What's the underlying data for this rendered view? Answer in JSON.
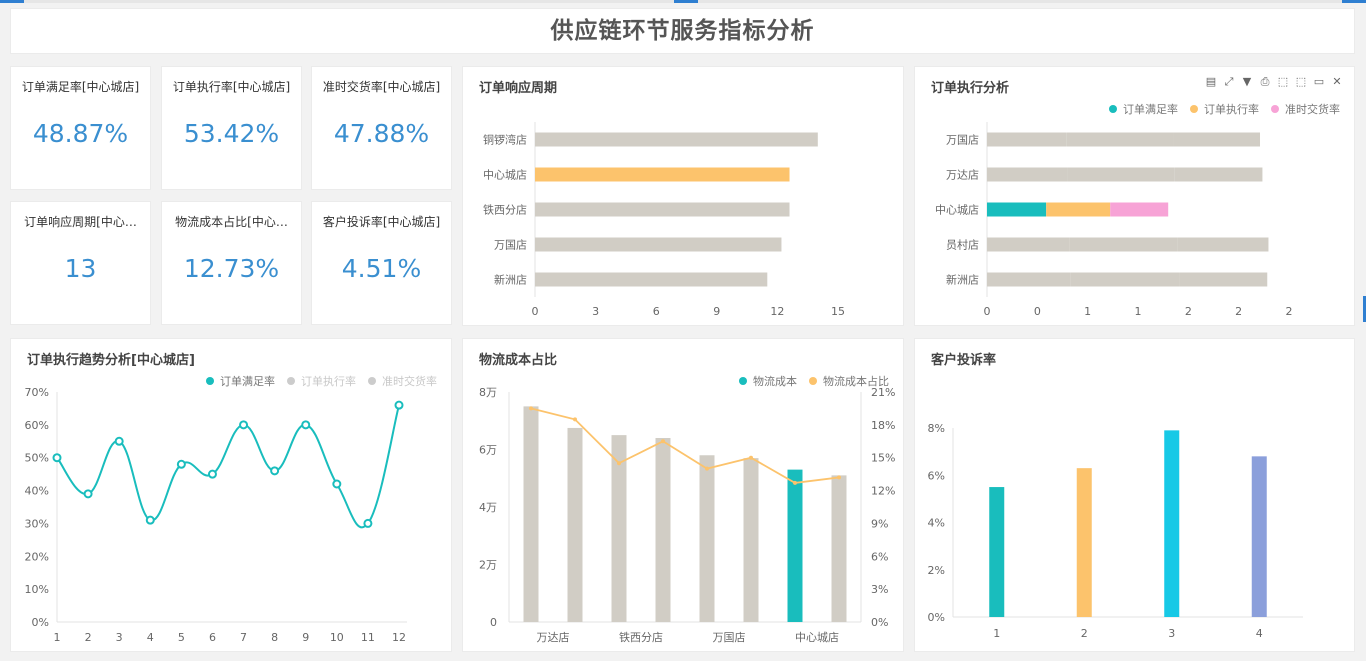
{
  "page_title": "供应链环节服务指标分析",
  "colors": {
    "teal": "#19bdbd",
    "orange": "#fcc36c",
    "pink": "#f7a3d6",
    "gray": "#d1cdc5",
    "cyan": "#17c9e6",
    "purple": "#8b9fdb",
    "kpi": "#3a8fd0"
  },
  "kpis": [
    {
      "title": "订单满足率[中心城店]",
      "value": "48.87%"
    },
    {
      "title": "订单执行率[中心城店]",
      "value": "53.42%"
    },
    {
      "title": "准时交货率[中心城店]",
      "value": "47.88%"
    },
    {
      "title": "订单响应周期[中心…",
      "value": "13"
    },
    {
      "title": "物流成本占比[中心…",
      "value": "12.73%"
    },
    {
      "title": "客户投诉率[中心城店]",
      "value": "4.51%"
    }
  ],
  "panels": {
    "response": {
      "title": "订单响应周期"
    },
    "execution": {
      "title": "订单执行分析",
      "toolbar": [
        "▤",
        "⤢",
        "▼",
        "⎙",
        "⬚",
        "⬚",
        "▭",
        "✕"
      ]
    },
    "trend": {
      "title": "订单执行趋势分析[中心城店]"
    },
    "logistics": {
      "title": "物流成本占比"
    },
    "complaint": {
      "title": "客户投诉率"
    }
  },
  "chart_data": [
    {
      "id": "response",
      "type": "bar",
      "orientation": "horizontal",
      "categories": [
        "铜锣湾店",
        "中心城店",
        "铁西分店",
        "万国店",
        "新洲店"
      ],
      "values": [
        14,
        12.6,
        12.6,
        12.2,
        11.5
      ],
      "highlight": "中心城店",
      "xlim": [
        0,
        15
      ],
      "xticks": [
        "0",
        "3",
        "6",
        "9",
        "12",
        "15"
      ]
    },
    {
      "id": "execution",
      "type": "bar",
      "orientation": "horizontal",
      "stacked": true,
      "categories": [
        "万国店",
        "万达店",
        "中心城店",
        "员村店",
        "新洲店"
      ],
      "series": [
        {
          "name": "订单满足率",
          "values": [
            0.66,
            0.67,
            0.49,
            0.68,
            0.69
          ]
        },
        {
          "name": "订单执行率",
          "values": [
            0.88,
            0.88,
            0.53,
            0.9,
            0.9
          ]
        },
        {
          "name": "准时交货率",
          "values": [
            0.72,
            0.73,
            0.48,
            0.75,
            0.73
          ]
        }
      ],
      "highlight": "中心城店",
      "xlim": [
        0,
        2.5
      ],
      "xticks": [
        "0",
        "0",
        "1",
        "1",
        "2",
        "2",
        "2"
      ],
      "legend_position": "top-right"
    },
    {
      "id": "trend",
      "type": "line",
      "x": [
        "1",
        "2",
        "3",
        "4",
        "5",
        "6",
        "7",
        "8",
        "9",
        "10",
        "11",
        "12"
      ],
      "series": [
        {
          "name": "订单满足率",
          "values": [
            50,
            39,
            55,
            31,
            48,
            45,
            60,
            46,
            60,
            42,
            30,
            66
          ]
        }
      ],
      "legend": [
        "订单满足率",
        "订单执行率",
        "准时交货率"
      ],
      "ylim": [
        0,
        70
      ],
      "yticks": [
        "0%",
        "10%",
        "20%",
        "30%",
        "40%",
        "50%",
        "60%",
        "70%"
      ]
    },
    {
      "id": "logistics",
      "type": "bar",
      "categories": [
        "万达店",
        "",
        "铁西分店",
        "",
        "万国店",
        "",
        "中心城店",
        ""
      ],
      "series": [
        {
          "name": "物流成本",
          "values": [
            75000,
            67500,
            65000,
            64000,
            58000,
            57000,
            53000,
            51000
          ]
        },
        {
          "name": "物流成本占比",
          "type": "line",
          "values": [
            19.5,
            18.5,
            14.5,
            16.5,
            14.0,
            15.0,
            12.7,
            13.2
          ]
        }
      ],
      "highlight_index": 6,
      "ylim": [
        0,
        80000
      ],
      "yticks": [
        "0",
        "2万",
        "4万",
        "6万",
        "8万"
      ],
      "y2lim": [
        0,
        21
      ],
      "y2ticks": [
        "0%",
        "3%",
        "6%",
        "9%",
        "12%",
        "15%",
        "18%",
        "21%"
      ],
      "legend_position": "top-right"
    },
    {
      "id": "complaint",
      "type": "bar",
      "categories": [
        "1",
        "2",
        "3",
        "4"
      ],
      "values": [
        5.5,
        6.3,
        7.9,
        6.8
      ],
      "ylim": [
        0,
        8
      ],
      "yticks": [
        "0%",
        "2%",
        "4%",
        "6%",
        "8%"
      ]
    }
  ]
}
